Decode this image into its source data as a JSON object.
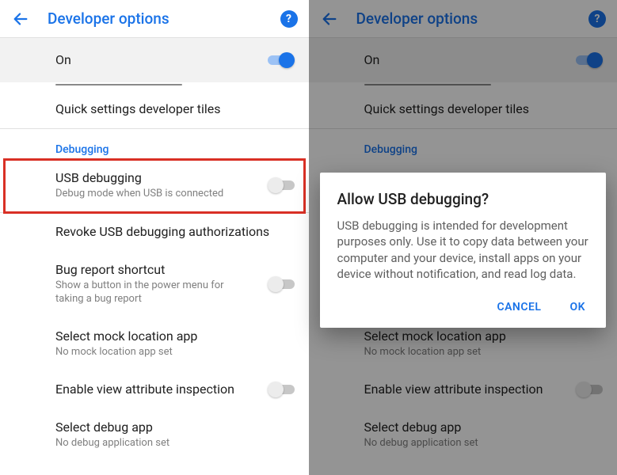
{
  "left": {
    "header": {
      "title": "Developer options"
    },
    "on_row": {
      "label": "On",
      "state": "on"
    },
    "items": [
      {
        "title": "Quick settings developer tiles"
      }
    ],
    "debug_section_label": "Debugging",
    "usb_debugging": {
      "title": "USB debugging",
      "subtitle": "Debug mode when USB is connected",
      "state": "off"
    },
    "rows_after": [
      {
        "title": "Revoke USB debugging authorizations"
      },
      {
        "title": "Bug report shortcut",
        "subtitle": "Show a button in the power menu for taking a bug report",
        "toggle": "off"
      },
      {
        "title": "Select mock location app",
        "subtitle": "No mock location app set"
      },
      {
        "title": "Enable view attribute inspection",
        "toggle": "off"
      },
      {
        "title": "Select debug app",
        "subtitle": "No debug application set"
      }
    ]
  },
  "right": {
    "header": {
      "title": "Developer options"
    },
    "on_row": {
      "label": "On",
      "state": "on"
    },
    "items": [
      {
        "title": "Quick settings developer tiles"
      }
    ],
    "debug_section_label": "Debugging",
    "rows_after": [
      {
        "title": "Select mock location app",
        "subtitle": "No mock location app set"
      },
      {
        "title": "Enable view attribute inspection",
        "toggle": "off"
      },
      {
        "title": "Select debug app",
        "subtitle": "No debug application set"
      }
    ],
    "dialog": {
      "title": "Allow USB debugging?",
      "body": "USB debugging is intended for development purposes only. Use it to copy data between your computer and your device, install apps on your device without notification, and read log data.",
      "cancel": "CANCEL",
      "ok": "OK"
    }
  }
}
